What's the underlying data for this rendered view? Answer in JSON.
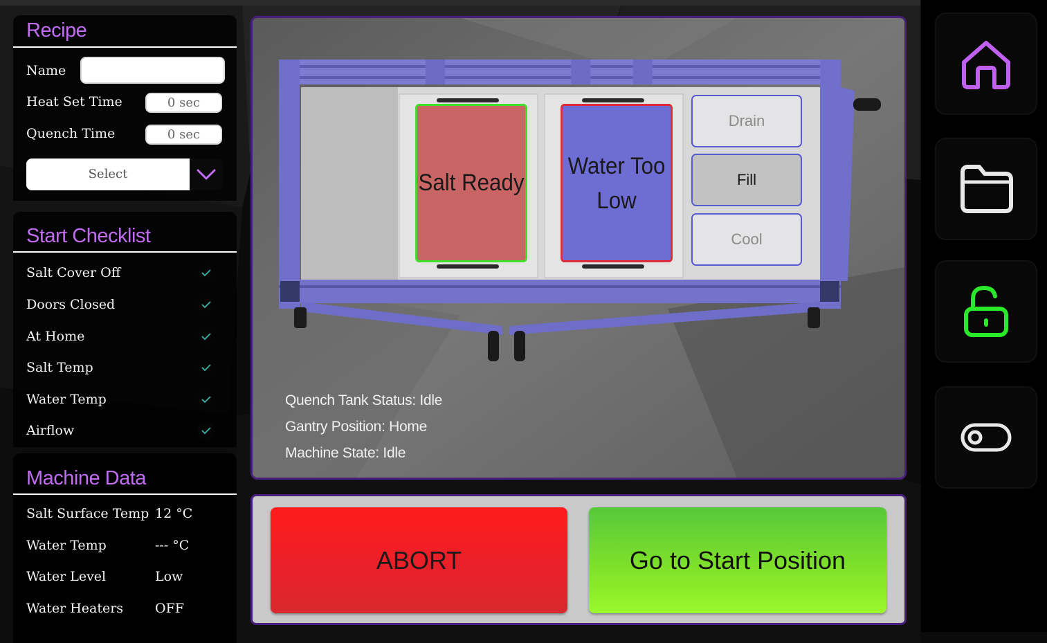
{
  "recipe": {
    "title": "Recipe",
    "name_label": "Name",
    "name_value": "",
    "heat_label": "Heat Set Time",
    "heat_value": "0 sec",
    "quench_label": "Quench Time",
    "quench_value": "0 sec",
    "select_label": "Select"
  },
  "checklist": {
    "title": "Start Checklist",
    "items": [
      {
        "label": "Salt Cover Off"
      },
      {
        "label": "Doors Closed"
      },
      {
        "label": "At Home"
      },
      {
        "label": "Salt Temp"
      },
      {
        "label": "Water Temp"
      },
      {
        "label": "Airflow"
      }
    ]
  },
  "machine": {
    "title": "Machine Data",
    "rows": [
      {
        "label": "Salt Surface Temp",
        "value": "12 °C"
      },
      {
        "label": "Water Temp",
        "value": "--- °C"
      },
      {
        "label": "Water Level",
        "value": "Low"
      },
      {
        "label": "Water Heaters",
        "value": "OFF"
      }
    ]
  },
  "viewer": {
    "salt_tile": "Salt Ready",
    "water_tile_line1": "Water Too",
    "water_tile_line2": "Low",
    "drain": "Drain",
    "fill": "Fill",
    "cool": "Cool",
    "status_quench": "Quench Tank Status: Idle",
    "status_gantry": "Gantry Position: Home",
    "status_machine": "Machine State: Idle"
  },
  "actions": {
    "abort": "ABORT",
    "start": "Go to Start Position"
  },
  "colors": {
    "accent_purple": "#c06cf0",
    "unlock_green": "#2ae82a",
    "check_teal": "#3fb5a8",
    "abort_red": "#ff1c1c",
    "start_green": "#7ee02a"
  },
  "nav": {
    "icons": [
      "home-icon",
      "folder-icon",
      "unlock-icon",
      "toggle-icon"
    ]
  }
}
